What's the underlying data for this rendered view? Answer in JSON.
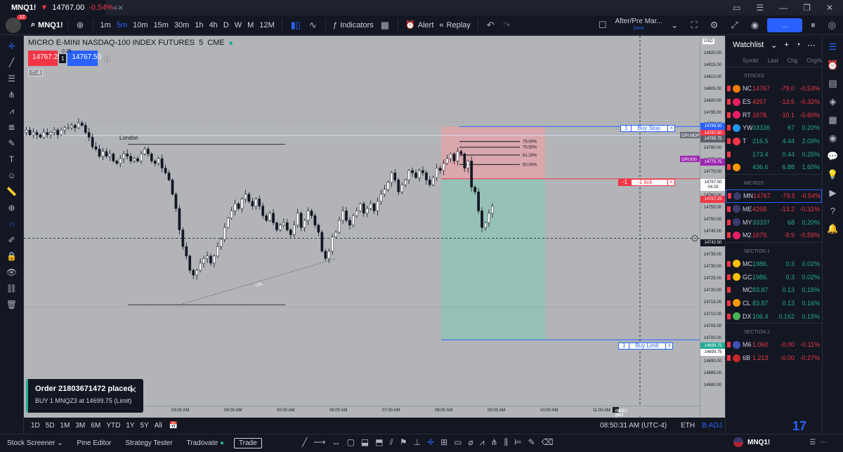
{
  "titlebar": {
    "tab_symbol": "MNQ1!",
    "tab_price": "14767.00",
    "tab_change": "-0.54%"
  },
  "toolbar": {
    "badge": "12",
    "symbol": "MNQ1!",
    "intervals": [
      "1m",
      "5m",
      "10m",
      "15m",
      "30m",
      "1h",
      "4h",
      "D",
      "W",
      "M",
      "12M"
    ],
    "active_interval": "5m",
    "indicators": "Indicators",
    "alert": "Alert",
    "replay": "Replay",
    "session_title": "After/Pre Mar...",
    "session_sub": "Save",
    "blue_button": "..."
  },
  "chart": {
    "legend_title": "MICRO E-MINI NASDAQ-100 INDEX FUTURES",
    "legend_interval": "5",
    "legend_exchange": "CME",
    "sell_price": "14767.25",
    "buy_price": "14767.50",
    "spread_top": "0.25",
    "spread": "1",
    "collapse": "4",
    "london_label": "London",
    "lrl_label": "LRL",
    "fib_levels": [
      "79.00%",
      "70.50%",
      "61.20%",
      "50.00%"
    ],
    "buy_stop": {
      "qty": "1",
      "label": "Buy Stop",
      "close": "×"
    },
    "position": {
      "qty": "-1",
      "label": "-1 tick",
      "close": "×"
    },
    "buy_limit": {
      "qty": "1",
      "label": "Buy Limit",
      "close": "×"
    },
    "opi_mop": "OPI:MOP",
    "opi_830": "OPI:830"
  },
  "price_axis": {
    "currency": "USD",
    "ticks": [
      "14820.00",
      "14815.00",
      "14810.00",
      "14805.00",
      "14800.00",
      "14795.00",
      "14790.00",
      "14785.00",
      "14780.00",
      "14775.00",
      "14770.00",
      "14765.00",
      "14760.00",
      "14755.00",
      "14750.00",
      "14745.00",
      "14740.00",
      "14735.00",
      "14730.00",
      "14725.00",
      "14720.00",
      "14715.00",
      "14710.00",
      "14705.00",
      "14700.00",
      "14695.00",
      "14690.00",
      "14685.00",
      "14680.00"
    ],
    "label_buy_stop": "14789.50",
    "label_red_1": "14787.50",
    "label_opi_mop": "14785.75",
    "label_opi_830": "14775.75",
    "label_last": "14767.50",
    "label_countdown": "04:29",
    "label_bid": "14767.25",
    "label_crosshair": "14742.50",
    "label_buy_limit": "14699.75",
    "label_low": "14699.75"
  },
  "time_axis": {
    "ticks": [
      "03:00 AM",
      "04:00 AM",
      "05:00 AM",
      "06:00 AM",
      "07:00 AM",
      "08:00 AM",
      "09:00 AM",
      "10:00 AM",
      "11:00 AM"
    ],
    "crosshair": "Wed 25 Oct '23",
    "crosshair_time": "11:50 AM"
  },
  "rangebar": {
    "ranges": [
      "1D",
      "5D",
      "1M",
      "3M",
      "6M",
      "YTD",
      "1Y",
      "5Y",
      "All"
    ],
    "clock": "08:50:31 AM (UTC-4)",
    "eth": "ETH",
    "badj": "B-ADJ"
  },
  "bottombar": {
    "items": [
      "Stock Screener",
      "Pine Editor",
      "Strategy Tester",
      "Tradovate"
    ],
    "trade": "Trade",
    "symbol": "MNQ1!"
  },
  "toast": {
    "title": "Order 21803671472 placed",
    "detail": "BUY 1 MNQZ3 at 14699.75 (Limit)"
  },
  "watchlist": {
    "title": "Watchlist",
    "columns": [
      "Symbl",
      "Last",
      "Chg",
      "Chg%"
    ],
    "sections": [
      {
        "name": "STOCKS",
        "rows": [
          {
            "sym": "NC",
            "last": "14767",
            "chg": "-79.0",
            "pct": "-0.53%",
            "dir": "r",
            "icon": "#f57c00"
          },
          {
            "sym": "ES",
            "last": "4257",
            "chg": "-13.5",
            "pct": "-0.32%",
            "dir": "r",
            "icon": "#e91e63"
          },
          {
            "sym": "RT",
            "last": "1678.",
            "chg": "-10.1",
            "pct": "-0.60%",
            "dir": "r",
            "icon": "#e91e63"
          },
          {
            "sym": "YW",
            "last": "33336",
            "chg": "67",
            "pct": "0.20%",
            "dir": "g",
            "icon": "#2196f3"
          },
          {
            "sym": "T",
            "last": "216.5",
            "chg": "4.44",
            "pct": "2.09%",
            "dir": "g",
            "icon": "#f23645"
          },
          {
            "sym": "",
            "last": "173.4",
            "chg": "0.44",
            "pct": "0.25%",
            "dir": "g",
            "icon": "#131722"
          },
          {
            "sym": "",
            "last": "436.6",
            "chg": "6.88",
            "pct": "1.60%",
            "dir": "g",
            "icon": "#ff9800"
          }
        ]
      },
      {
        "name": "MICROS",
        "rows": [
          {
            "sym": "MN",
            "last": "14767",
            "chg": "-79.5",
            "pct": "-0.54%",
            "dir": "r",
            "icon": "#3c3b6e",
            "selected": true
          },
          {
            "sym": "ME",
            "last": "4258",
            "chg": "-13.2",
            "pct": "-0.31%",
            "dir": "r",
            "icon": "#3c3b6e"
          },
          {
            "sym": "MY",
            "last": "33337",
            "chg": "68",
            "pct": "0.20%",
            "dir": "g",
            "icon": "#3c3b6e"
          },
          {
            "sym": "M2",
            "last": "1679.",
            "chg": "-9.9",
            "pct": "-0.59%",
            "dir": "r",
            "icon": "#e91e63"
          }
        ]
      },
      {
        "name": "SECTION 1",
        "rows": [
          {
            "sym": "MC",
            "last": "1986.",
            "chg": "0.3",
            "pct": "0.02%",
            "dir": "g",
            "icon": "#ffc107"
          },
          {
            "sym": "GC",
            "last": "1986.",
            "chg": "0.3",
            "pct": "0.02%",
            "dir": "g",
            "icon": "#ffc107"
          },
          {
            "sym": "MC",
            "last": "83.87",
            "chg": "0.13",
            "pct": "0.16%",
            "dir": "g",
            "icon": "#131722"
          },
          {
            "sym": "CL",
            "last": "83.87",
            "chg": "0.13",
            "pct": "0.16%",
            "dir": "g",
            "icon": "#ff9800"
          },
          {
            "sym": "DX",
            "last": "106.4",
            "chg": "0.162",
            "pct": "0.15%",
            "dir": "g",
            "icon": "#4caf50"
          }
        ]
      },
      {
        "name": "SECTION 2",
        "rows": [
          {
            "sym": "M6",
            "last": "1.060",
            "chg": "-0.00",
            "pct": "-0.11%",
            "dir": "r",
            "icon": "#3f51b5"
          },
          {
            "sym": "6B",
            "last": "1.213",
            "chg": "-0.00",
            "pct": "-0.27%",
            "dir": "r",
            "icon": "#c62828"
          }
        ]
      }
    ]
  },
  "colors": {
    "accent": "#2962ff",
    "up": "#22ab94",
    "down": "#f23645",
    "chart_bg": "#b2b4b8"
  }
}
